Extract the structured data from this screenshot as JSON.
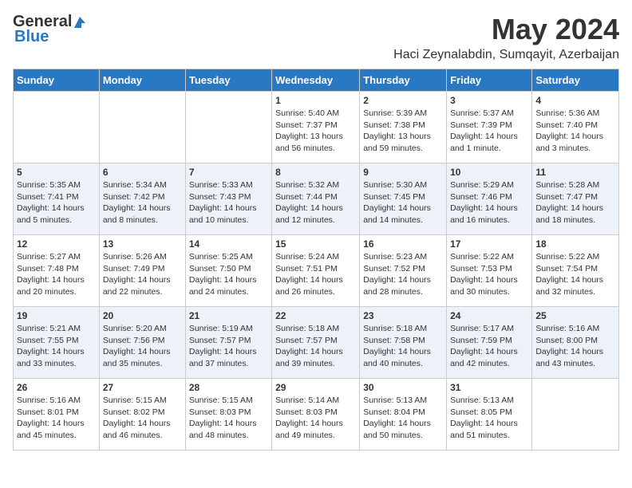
{
  "logo": {
    "general": "General",
    "blue": "Blue"
  },
  "title": "May 2024",
  "location": "Haci Zeynalabdin, Sumqayit, Azerbaijan",
  "days_of_week": [
    "Sunday",
    "Monday",
    "Tuesday",
    "Wednesday",
    "Thursday",
    "Friday",
    "Saturday"
  ],
  "weeks": [
    [
      {
        "day": "",
        "info": ""
      },
      {
        "day": "",
        "info": ""
      },
      {
        "day": "",
        "info": ""
      },
      {
        "day": "1",
        "info": "Sunrise: 5:40 AM\nSunset: 7:37 PM\nDaylight: 13 hours\nand 56 minutes."
      },
      {
        "day": "2",
        "info": "Sunrise: 5:39 AM\nSunset: 7:38 PM\nDaylight: 13 hours\nand 59 minutes."
      },
      {
        "day": "3",
        "info": "Sunrise: 5:37 AM\nSunset: 7:39 PM\nDaylight: 14 hours\nand 1 minute."
      },
      {
        "day": "4",
        "info": "Sunrise: 5:36 AM\nSunset: 7:40 PM\nDaylight: 14 hours\nand 3 minutes."
      }
    ],
    [
      {
        "day": "5",
        "info": "Sunrise: 5:35 AM\nSunset: 7:41 PM\nDaylight: 14 hours\nand 5 minutes."
      },
      {
        "day": "6",
        "info": "Sunrise: 5:34 AM\nSunset: 7:42 PM\nDaylight: 14 hours\nand 8 minutes."
      },
      {
        "day": "7",
        "info": "Sunrise: 5:33 AM\nSunset: 7:43 PM\nDaylight: 14 hours\nand 10 minutes."
      },
      {
        "day": "8",
        "info": "Sunrise: 5:32 AM\nSunset: 7:44 PM\nDaylight: 14 hours\nand 12 minutes."
      },
      {
        "day": "9",
        "info": "Sunrise: 5:30 AM\nSunset: 7:45 PM\nDaylight: 14 hours\nand 14 minutes."
      },
      {
        "day": "10",
        "info": "Sunrise: 5:29 AM\nSunset: 7:46 PM\nDaylight: 14 hours\nand 16 minutes."
      },
      {
        "day": "11",
        "info": "Sunrise: 5:28 AM\nSunset: 7:47 PM\nDaylight: 14 hours\nand 18 minutes."
      }
    ],
    [
      {
        "day": "12",
        "info": "Sunrise: 5:27 AM\nSunset: 7:48 PM\nDaylight: 14 hours\nand 20 minutes."
      },
      {
        "day": "13",
        "info": "Sunrise: 5:26 AM\nSunset: 7:49 PM\nDaylight: 14 hours\nand 22 minutes."
      },
      {
        "day": "14",
        "info": "Sunrise: 5:25 AM\nSunset: 7:50 PM\nDaylight: 14 hours\nand 24 minutes."
      },
      {
        "day": "15",
        "info": "Sunrise: 5:24 AM\nSunset: 7:51 PM\nDaylight: 14 hours\nand 26 minutes."
      },
      {
        "day": "16",
        "info": "Sunrise: 5:23 AM\nSunset: 7:52 PM\nDaylight: 14 hours\nand 28 minutes."
      },
      {
        "day": "17",
        "info": "Sunrise: 5:22 AM\nSunset: 7:53 PM\nDaylight: 14 hours\nand 30 minutes."
      },
      {
        "day": "18",
        "info": "Sunrise: 5:22 AM\nSunset: 7:54 PM\nDaylight: 14 hours\nand 32 minutes."
      }
    ],
    [
      {
        "day": "19",
        "info": "Sunrise: 5:21 AM\nSunset: 7:55 PM\nDaylight: 14 hours\nand 33 minutes."
      },
      {
        "day": "20",
        "info": "Sunrise: 5:20 AM\nSunset: 7:56 PM\nDaylight: 14 hours\nand 35 minutes."
      },
      {
        "day": "21",
        "info": "Sunrise: 5:19 AM\nSunset: 7:57 PM\nDaylight: 14 hours\nand 37 minutes."
      },
      {
        "day": "22",
        "info": "Sunrise: 5:18 AM\nSunset: 7:57 PM\nDaylight: 14 hours\nand 39 minutes."
      },
      {
        "day": "23",
        "info": "Sunrise: 5:18 AM\nSunset: 7:58 PM\nDaylight: 14 hours\nand 40 minutes."
      },
      {
        "day": "24",
        "info": "Sunrise: 5:17 AM\nSunset: 7:59 PM\nDaylight: 14 hours\nand 42 minutes."
      },
      {
        "day": "25",
        "info": "Sunrise: 5:16 AM\nSunset: 8:00 PM\nDaylight: 14 hours\nand 43 minutes."
      }
    ],
    [
      {
        "day": "26",
        "info": "Sunrise: 5:16 AM\nSunset: 8:01 PM\nDaylight: 14 hours\nand 45 minutes."
      },
      {
        "day": "27",
        "info": "Sunrise: 5:15 AM\nSunset: 8:02 PM\nDaylight: 14 hours\nand 46 minutes."
      },
      {
        "day": "28",
        "info": "Sunrise: 5:15 AM\nSunset: 8:03 PM\nDaylight: 14 hours\nand 48 minutes."
      },
      {
        "day": "29",
        "info": "Sunrise: 5:14 AM\nSunset: 8:03 PM\nDaylight: 14 hours\nand 49 minutes."
      },
      {
        "day": "30",
        "info": "Sunrise: 5:13 AM\nSunset: 8:04 PM\nDaylight: 14 hours\nand 50 minutes."
      },
      {
        "day": "31",
        "info": "Sunrise: 5:13 AM\nSunset: 8:05 PM\nDaylight: 14 hours\nand 51 minutes."
      },
      {
        "day": "",
        "info": ""
      }
    ]
  ]
}
